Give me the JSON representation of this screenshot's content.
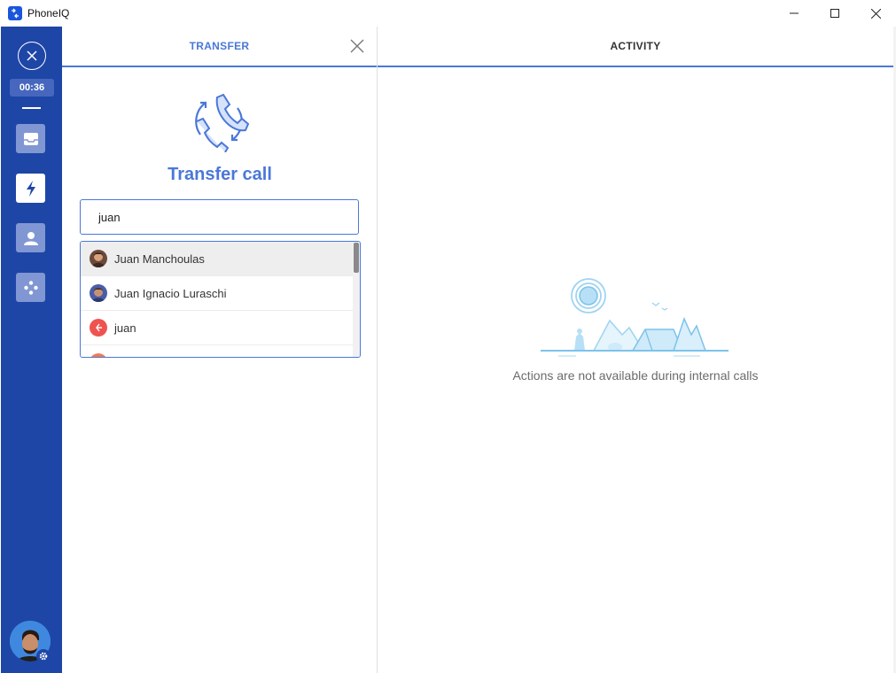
{
  "window": {
    "title": "PhoneIQ"
  },
  "sidebar": {
    "timer": "00:36",
    "nav": [
      {
        "icon": "inbox-icon"
      },
      {
        "icon": "lightning-icon",
        "active": true
      },
      {
        "icon": "contact-icon"
      },
      {
        "icon": "dialpad-icon"
      }
    ]
  },
  "transfer": {
    "header": "TRANSFER",
    "title": "Transfer call",
    "search_value": "juan",
    "results": [
      {
        "name": "Juan Manchoulas"
      },
      {
        "name": "Juan Ignacio Luraschi"
      },
      {
        "name": "juan"
      }
    ]
  },
  "activity": {
    "header": "ACTIVITY",
    "empty_message": "Actions are not available during internal calls"
  },
  "colors": {
    "sidebar": "#1e46a6",
    "accent": "#4a78d8"
  }
}
